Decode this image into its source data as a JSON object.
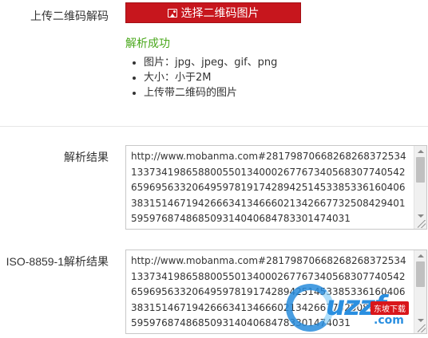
{
  "upload": {
    "label": "上传二维码解码",
    "button_label": "选择二维码图片",
    "button_icon": "image-icon",
    "button_color": "#c7161d"
  },
  "status": {
    "text": "解析成功",
    "color": "#4aa81c"
  },
  "tips": [
    "图片：jpg、jpeg、gif、png",
    "大小：小于2M",
    "上传带二维码的图片"
  ],
  "result": {
    "label": "解析结果",
    "text": "http://www.mobanma.com#28179870668268268372534133734198658800550134000267767340568307740542659695633206495978191742894251453385336160406383151467194266634134666021342667732508429401595976874868509314040684783301474031"
  },
  "iso_result": {
    "label": "ISO-8859-1解析结果",
    "text": "http://www.mobanma.com#28179870668268268372534133734198658800550134000267767340568307740542659695633206495978191742894251453385336160406383151467194266634134666021342667732508429401595976874868509314040684783301474031"
  },
  "watermark": {
    "text": "uzzf",
    "badge": "东坡下载",
    "suffix": ".com"
  }
}
